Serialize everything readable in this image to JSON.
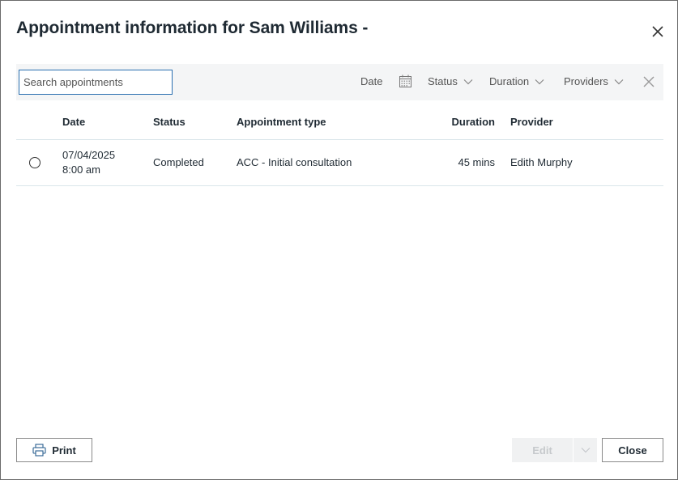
{
  "dialog": {
    "title": "Appointment information for Sam Williams -",
    "close_icon": "close-icon"
  },
  "filters": {
    "search_placeholder": "Search appointments",
    "date_label": "Date",
    "calendar_icon": "calendar-icon",
    "status_label": "Status",
    "duration_label": "Duration",
    "providers_label": "Providers",
    "clear_icon": "clear-filters-icon"
  },
  "table": {
    "columns": [
      "Date",
      "Status",
      "Appointment type",
      "Duration",
      "Provider"
    ],
    "rows": [
      {
        "date": "07/04/2025",
        "time": "8:00 am",
        "status": "Completed",
        "type": "ACC - Initial consultation",
        "duration": "45 mins",
        "provider": "Edith Murphy"
      }
    ]
  },
  "footer": {
    "print_label": "Print",
    "print_icon": "printer-icon",
    "edit_label": "Edit",
    "close_label": "Close"
  },
  "colors": {
    "accent": "#2a6fb0",
    "filterbar_bg": "#f4f5f6",
    "row_border": "#d9e5ea",
    "disabled_text": "#c6c9cc"
  }
}
